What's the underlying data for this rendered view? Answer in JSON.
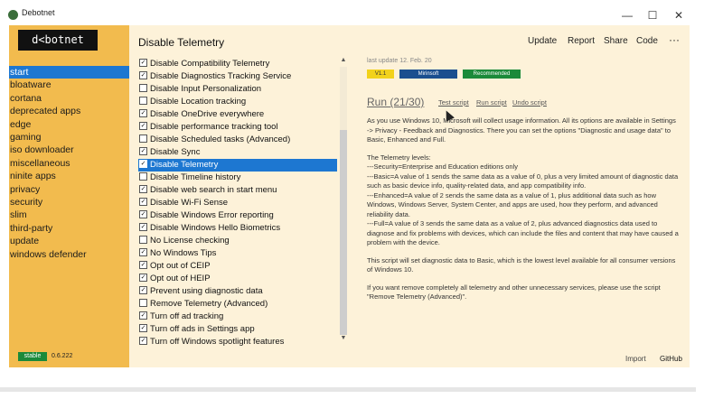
{
  "window": {
    "title": "Debotnet",
    "controls": {
      "minimize": "—",
      "maximize": "☐",
      "close": "✕"
    }
  },
  "sidebar": {
    "logo": "d<botnet",
    "categories": [
      "start",
      "bloatware",
      "cortana",
      "deprecated apps",
      "edge",
      "gaming",
      "iso downloader",
      "miscellaneous",
      "ninite apps",
      "privacy",
      "security",
      "slim",
      "third-party",
      "update",
      "windows defender"
    ],
    "active_category": "start",
    "badge": "stable",
    "version": "0.6.222"
  },
  "header": {
    "title": "Disable Telemetry",
    "menu": {
      "update": "Update",
      "report": "Report",
      "share": "Share",
      "code": "Code",
      "more": "···"
    }
  },
  "list": {
    "items": [
      {
        "label": "Disable Compatibility Telemetry",
        "checked": true
      },
      {
        "label": "Disable Diagnostics Tracking Service",
        "checked": true
      },
      {
        "label": "Disable Input Personalization",
        "checked": false
      },
      {
        "label": "Disable Location tracking",
        "checked": false
      },
      {
        "label": "Disable OneDrive everywhere",
        "checked": true
      },
      {
        "label": "Disable performance tracking tool",
        "checked": true
      },
      {
        "label": "Disable Scheduled tasks (Advanced)",
        "checked": false
      },
      {
        "label": "Disable Sync",
        "checked": true
      },
      {
        "label": "Disable Telemetry",
        "checked": true,
        "selected": true
      },
      {
        "label": "Disable Timeline history",
        "checked": false
      },
      {
        "label": "Disable web search in start menu",
        "checked": true
      },
      {
        "label": "Disable Wi-Fi Sense",
        "checked": true
      },
      {
        "label": "Disable Windows Error reporting",
        "checked": true
      },
      {
        "label": "Disable Windows Hello Biometrics",
        "checked": true
      },
      {
        "label": "No License checking",
        "checked": false
      },
      {
        "label": "No Windows Tips",
        "checked": true
      },
      {
        "label": "Opt out of CEIP",
        "checked": true
      },
      {
        "label": "Opt out of HEIP",
        "checked": true
      },
      {
        "label": "Prevent using diagnostic data",
        "checked": true
      },
      {
        "label": "Remove Telemetry (Advanced)",
        "checked": false
      },
      {
        "label": "Turn off ad tracking",
        "checked": true
      },
      {
        "label": "Turn off ads in Settings app",
        "checked": true
      },
      {
        "label": "Turn off Windows spotlight features",
        "checked": true
      }
    ]
  },
  "detail": {
    "last_update": "last update 12. Feb. 20",
    "badges": [
      {
        "label": "V1.1",
        "bg": "#f2d21b",
        "fg": "#333333"
      },
      {
        "label": "Mirinsoft",
        "bg": "#1a4f8f",
        "fg": "#ffffff"
      },
      {
        "label": "Recommended",
        "bg": "#1b8a3a",
        "fg": "#ffffff"
      }
    ],
    "run_title": "Run (21/30)",
    "links": {
      "test": "Test script",
      "run": "Run script",
      "undo": "Undo script"
    },
    "paragraphs": [
      "As you use Windows 10, Microsoft will collect usage information. All its options are available in Settings -> Privacy - Feedback and Diagnostics. There you can set the options \"Diagnostic and usage data\" to Basic, Enhanced and Full.",
      "The Telemetry levels:\n---Security=Enterprise and Education editions only\n---Basic=A value of 1 sends the same data as a value of 0, plus a very limited amount of diagnostic data such as basic device info, quality-related data, and app compatibility info.\n---Enhanced=A value of 2 sends the same data as a value of 1, plus additional data such as how Windows, Windows Server, System Center, and apps are used, how they perform, and advanced reliability data.\n---Full=A value of 3 sends the same data as a value of 2, plus advanced diagnostics data used to diagnose and fix problems with devices, which can include the files and content that may have caused a problem with the device.",
      "This script will set diagnostic data to Basic, which is the lowest level available for all consumer versions of Windows 10.",
      "If you want remove completely all telemetry and other unnecessary services, please use the script \"Remove Telemetry (Advanced)\"."
    ]
  },
  "footer": {
    "import": "Import",
    "github": "GitHub"
  },
  "colors": {
    "sidebar": "#f2bb4e",
    "content": "#fdf2d9",
    "accent": "#1d77d1"
  }
}
